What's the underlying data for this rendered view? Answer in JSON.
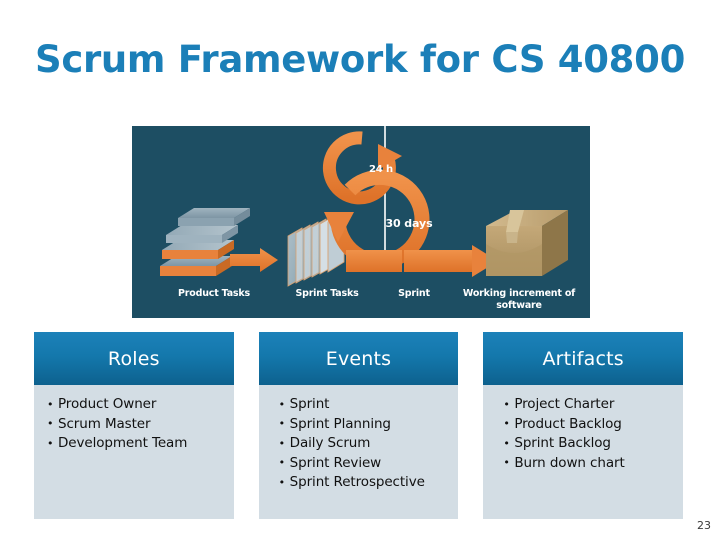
{
  "slide": {
    "title": "Scrum Framework for CS 40800",
    "title_color": "#1b7fb8",
    "page_number": "23"
  },
  "diagram": {
    "name": "scrum-framework-diagram",
    "background_color": "#1d4e63",
    "accent_color": "#e8823c",
    "captions": {
      "product_tasks": "Product Tasks",
      "sprint_tasks": "Sprint Tasks",
      "sprint": "Sprint",
      "working_increment": "Working increment of software"
    },
    "cycles": {
      "daily": "24 h",
      "sprint": "30 days"
    }
  },
  "table": {
    "header_color_top": "#1c81b9",
    "header_color_bottom": "#0d618e",
    "body_color": "#d3dde4",
    "columns": [
      {
        "header": "Roles",
        "items": [
          "Product Owner",
          "Scrum Master",
          "Development Team"
        ]
      },
      {
        "header": "Events",
        "items": [
          "Sprint",
          "Sprint Planning",
          "Daily Scrum",
          "Sprint Review",
          "Sprint Retrospective"
        ]
      },
      {
        "header": "Artifacts",
        "items": [
          "Project Charter",
          "Product Backlog",
          "Sprint Backlog",
          "Burn down chart"
        ]
      }
    ]
  }
}
